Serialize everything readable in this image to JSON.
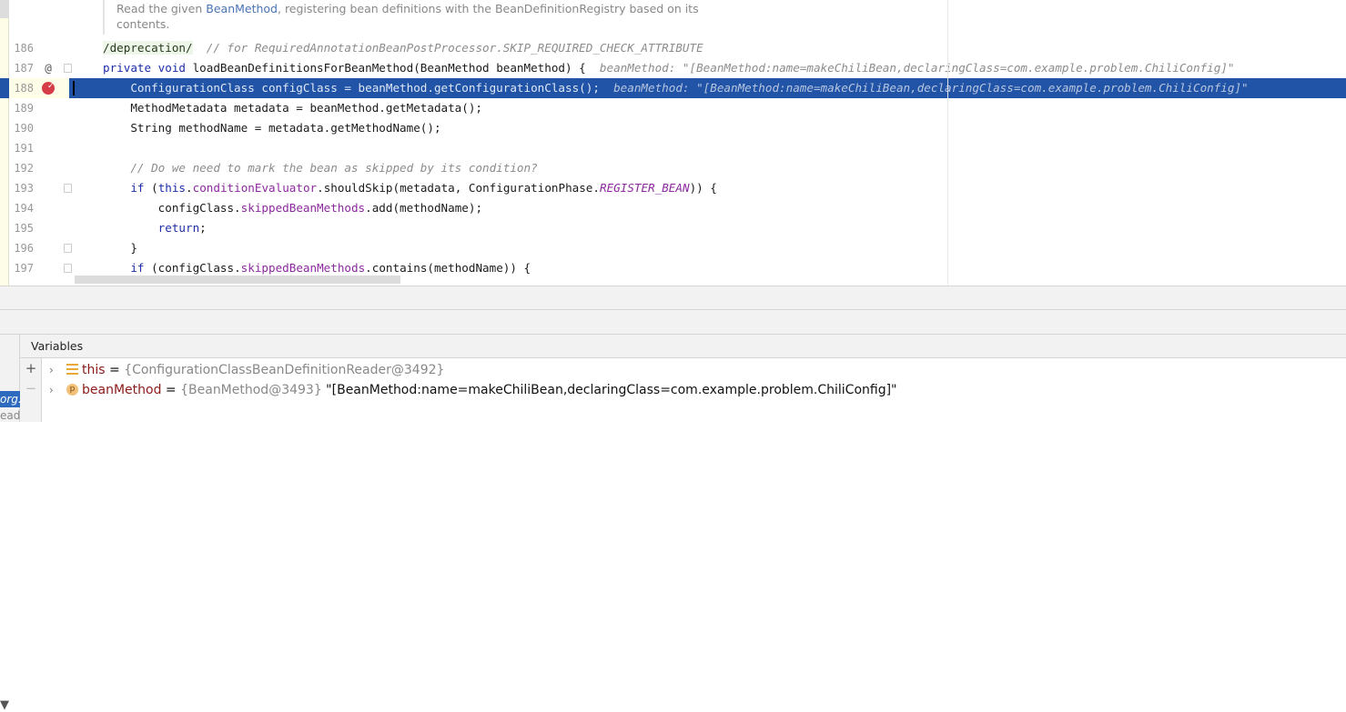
{
  "doc_comment": {
    "pre": "Read the given ",
    "link": "BeanMethod",
    "post": ", registering bean definitions with the BeanDefinitionRegistry based on its",
    "line2": "contents."
  },
  "lines": [
    {
      "num": "186",
      "tokens": [
        [
          "/deprecation/",
          "dep"
        ],
        [
          "  // for RequiredAnnotationBeanPostProcessor.SKIP_REQUIRED_CHECK_ATTRIBUTE",
          "cmt"
        ]
      ]
    },
    {
      "num": "187",
      "icon": "@",
      "fold": true,
      "tokens": [
        [
          "private void ",
          "kw"
        ],
        [
          "loadBeanDefinitionsForBeanMethod(BeanMethod beanMethod) {",
          ""
        ],
        [
          "  beanMethod: \"[BeanMethod:name=makeChiliBean,declaringClass=com.example.problem.ChiliConfig]\"",
          "hint"
        ]
      ]
    },
    {
      "num": "188",
      "current": true,
      "tokens": [
        [
          "    ConfigurationClass configClass = beanMethod.getConfigurationClass();",
          ""
        ],
        [
          "  beanMethod: \"[BeanMethod:name=makeChiliBean,declaringClass=com.example.problem.ChiliConfig]\"",
          "hint"
        ]
      ]
    },
    {
      "num": "189",
      "tokens": [
        [
          "    MethodMetadata metadata = beanMethod.getMetadata();",
          ""
        ]
      ]
    },
    {
      "num": "190",
      "tokens": [
        [
          "    String methodName = metadata.getMethodName();",
          ""
        ]
      ]
    },
    {
      "num": "191",
      "tokens": []
    },
    {
      "num": "192",
      "tokens": [
        [
          "    // Do we need to mark the bean as skipped by its condition?",
          "cmt"
        ]
      ]
    },
    {
      "num": "193",
      "fold": true,
      "tokens": [
        [
          "    ",
          ""
        ],
        [
          "if ",
          "kw"
        ],
        [
          "(",
          ""
        ],
        [
          "this",
          "kw"
        ],
        [
          ".",
          ""
        ],
        [
          "conditionEvaluator",
          "fld"
        ],
        [
          ".shouldSkip(metadata, ConfigurationPhase.",
          ""
        ],
        [
          "REGISTER_BEAN",
          "cst"
        ],
        [
          ")) {",
          ""
        ]
      ]
    },
    {
      "num": "194",
      "tokens": [
        [
          "        configClass.",
          ""
        ],
        [
          "skippedBeanMethods",
          "fld"
        ],
        [
          ".add(methodName);",
          ""
        ]
      ]
    },
    {
      "num": "195",
      "tokens": [
        [
          "        ",
          ""
        ],
        [
          "return",
          "kw"
        ],
        [
          ";",
          ""
        ]
      ]
    },
    {
      "num": "196",
      "fold": true,
      "tokens": [
        [
          "    }",
          ""
        ]
      ]
    },
    {
      "num": "197",
      "fold": true,
      "tokens": [
        [
          "    ",
          ""
        ],
        [
          "if ",
          "kw"
        ],
        [
          "(configClass.",
          ""
        ],
        [
          "skippedBeanMethods",
          "fld"
        ],
        [
          ".contains(methodName)) {",
          ""
        ]
      ]
    }
  ],
  "frames": {
    "selected": "org.",
    "next": "eade"
  },
  "variables": {
    "title": "Variables",
    "add": "+",
    "remove": "−",
    "items": [
      {
        "name": "this",
        "eq": " = ",
        "type": "{ConfigurationClassBeanDefinitionReader@3492}",
        "value": "",
        "icon": "stack-icon"
      },
      {
        "name": "beanMethod",
        "eq": " = ",
        "type": "{BeanMethod@3493}",
        "value": " \"[BeanMethod:name=makeChiliBean,declaringClass=com.example.problem.ChiliConfig]\"",
        "icon": "parameter-icon",
        "icon_letter": "p"
      }
    ]
  }
}
